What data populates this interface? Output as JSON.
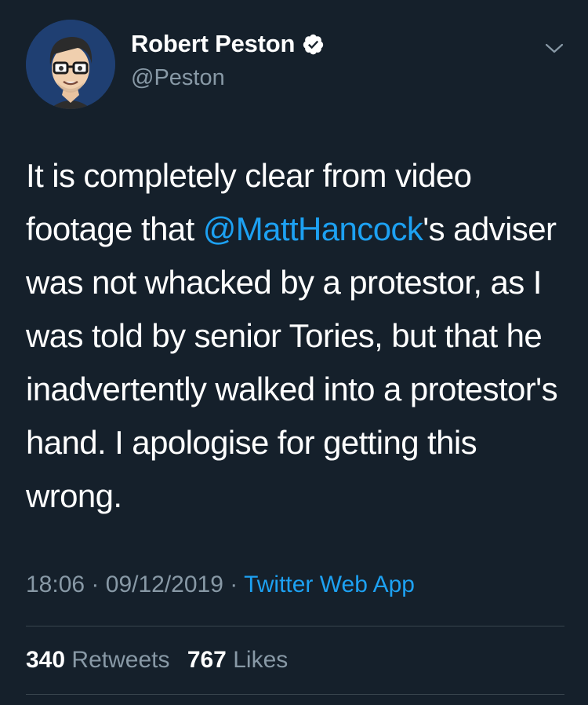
{
  "author": {
    "display_name": "Robert Peston",
    "handle": "@Peston",
    "verified": true
  },
  "tweet": {
    "text_part1": "It is completely clear from video footage that ",
    "mention": "@MattHancock",
    "text_part2": "'s adviser was not whacked by a protestor, as I was told by senior Tories, but that he inadvertently walked into a protestor's hand. I apologise for getting this wrong."
  },
  "meta": {
    "time": "18:06",
    "separator": "·",
    "date": "09/12/2019",
    "source": "Twitter Web App"
  },
  "stats": {
    "retweets_count": "340",
    "retweets_label": "Retweets",
    "likes_count": "767",
    "likes_label": "Likes"
  },
  "colors": {
    "background": "#15202b",
    "accent": "#1da1f2",
    "secondary_text": "#8899a6",
    "divider": "#38444d"
  },
  "icons": {
    "verified": "verified-badge-icon",
    "menu": "chevron-down-icon"
  }
}
